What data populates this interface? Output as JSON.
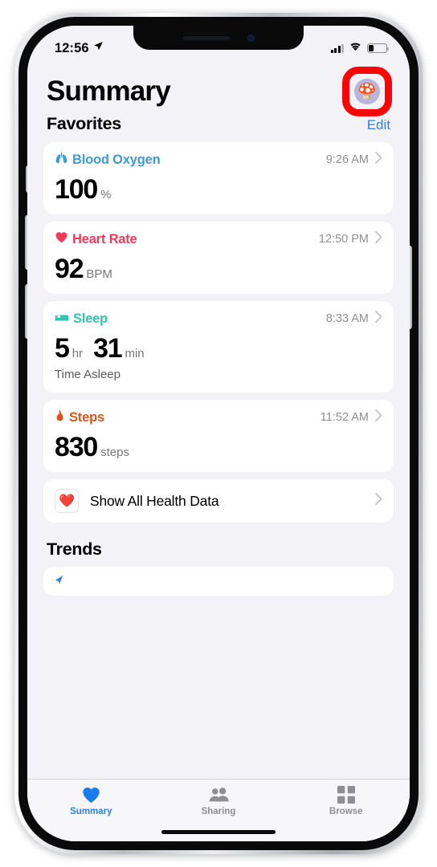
{
  "status_bar": {
    "time": "12:56",
    "location_icon": "location-arrow-icon",
    "cellular_icon": "cellular-signal-icon",
    "wifi_icon": "wifi-icon",
    "battery_icon": "battery-icon",
    "battery_level_percent": 30
  },
  "header": {
    "title": "Summary",
    "avatar_emoji": "🍄",
    "avatar_icon": "profile-avatar-icon",
    "highlight_color": "#f90505"
  },
  "favorites": {
    "section_title": "Favorites",
    "edit_label": "Edit",
    "edit_color": "#2e81e8",
    "cards": [
      {
        "name": "Blood Oxygen",
        "icon": "lungs-icon",
        "color": "#3b9cd4",
        "time": "9:26 AM",
        "value": "100",
        "unit": "%",
        "subtitle": ""
      },
      {
        "name": "Heart Rate",
        "icon": "heart-icon",
        "color": "#f2395a",
        "time": "12:50 PM",
        "value": "92",
        "unit": "BPM",
        "subtitle": ""
      },
      {
        "name": "Sleep",
        "icon": "bed-icon",
        "color": "#2ec4b0",
        "time": "8:33 AM",
        "value": "5",
        "unit": "hr",
        "value2": "31",
        "unit2": "min",
        "subtitle": "Time Asleep"
      },
      {
        "name": "Steps",
        "icon": "footsteps-flame-icon",
        "color": "#d9541e",
        "time": "11:52 AM",
        "value": "830",
        "unit": "steps",
        "subtitle": ""
      }
    ],
    "show_all": {
      "label": "Show All Health Data",
      "icon": "health-app-icon",
      "emoji": "❤️",
      "chevron": "chevron-right-icon"
    }
  },
  "trends": {
    "section_title": "Trends"
  },
  "tab_bar": {
    "items": [
      {
        "label": "Summary",
        "icon": "heart-filled-icon",
        "active": true
      },
      {
        "label": "Sharing",
        "icon": "people-icon",
        "active": false
      },
      {
        "label": "Browse",
        "icon": "grid-icon",
        "active": false
      }
    ]
  }
}
